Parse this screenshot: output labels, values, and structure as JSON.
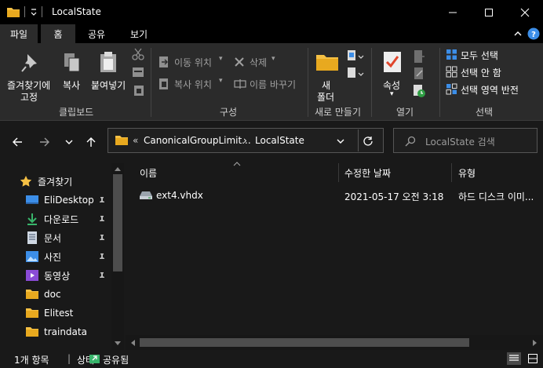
{
  "window": {
    "title": "LocalState",
    "controls": [
      "minimize",
      "maximize",
      "close"
    ]
  },
  "ribbon_tabs": [
    {
      "label": "파일"
    },
    {
      "label": "홈"
    },
    {
      "label": "공유"
    },
    {
      "label": "보기"
    }
  ],
  "ribbon": {
    "clipboard": {
      "pin_label_1": "즐겨찾기에",
      "pin_label_2": "고정",
      "copy": "복사",
      "paste": "붙여넣기",
      "group": "클립보드"
    },
    "organize": {
      "move_to": "이동 위치",
      "copy_to": "복사 위치",
      "delete": "삭제",
      "rename": "이름 바꾸기",
      "group": "구성"
    },
    "new": {
      "new_folder_1": "새",
      "new_folder_2": "폴더",
      "group": "새로 만들기"
    },
    "open": {
      "properties": "속성",
      "group": "열기"
    },
    "select": {
      "select_all": "모두 선택",
      "select_none": "선택 안 함",
      "invert": "선택 영역 반전",
      "group": "선택"
    }
  },
  "address": {
    "prefix": "«",
    "crumb1": "CanonicalGroupLimit...",
    "sep": "›",
    "crumb2": "LocalState"
  },
  "search": {
    "placeholder": "LocalState 검색"
  },
  "nav_pane": {
    "quick_access": "즐겨찾기",
    "items": [
      {
        "label": "EliDesktop",
        "pinned": true
      },
      {
        "label": "다운로드",
        "pinned": true
      },
      {
        "label": "문서",
        "pinned": true
      },
      {
        "label": "사진",
        "pinned": true
      },
      {
        "label": "동영상",
        "pinned": true
      },
      {
        "label": "doc",
        "pinned": false
      },
      {
        "label": "Elitest",
        "pinned": false
      },
      {
        "label": "traindata",
        "pinned": false
      }
    ]
  },
  "file_list": {
    "columns": [
      "이름",
      "수정한 날짜",
      "유형"
    ],
    "rows": [
      {
        "name": "ext4.vhdx",
        "modified": "2021-05-17 오전 3:18",
        "type": "하드 디스크 이미..."
      }
    ]
  },
  "status": {
    "count": "1개 항목",
    "sep": "|",
    "state_label": "상태:",
    "state_value": "공유됨"
  },
  "colors": {
    "background": "#191919",
    "ribbon": "#2b2b2b",
    "titlebar": "#000000",
    "folder": "#f5c044",
    "accent_blue": "#3c8ee8"
  }
}
